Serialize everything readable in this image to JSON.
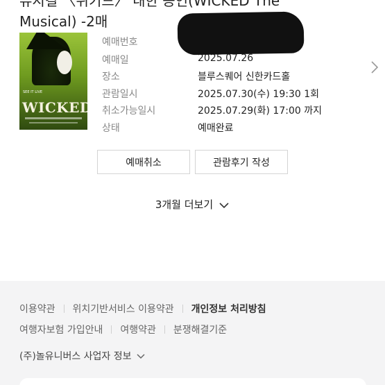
{
  "title": {
    "line1": "뮤지컬 〈위키드〉 내한 공연(WICKED The",
    "line2": "Musical) -2매"
  },
  "poster": {
    "logo": "WICKED",
    "tagline": "SEE IT LIVE"
  },
  "details": [
    {
      "label": "예매번호",
      "value": ""
    },
    {
      "label": "예매일",
      "value": "2025.07.26"
    },
    {
      "label": "장소",
      "value": "블루스퀘어 신한카드홀"
    },
    {
      "label": "관람일시",
      "value": "2025.07.30(수) 19:30 1회"
    },
    {
      "label": "취소가능일시",
      "value": "2025.07.29(화) 17:00 까지"
    },
    {
      "label": "상태",
      "value": "예매완료"
    }
  ],
  "buttons": {
    "cancel": "예매취소",
    "review": "관람후기 작성"
  },
  "more": {
    "label": "3개월 더보기"
  },
  "footer": {
    "links_row1": [
      "이용약관",
      "위치기반서비스 이용약관",
      "개인정보 처리방침"
    ],
    "links_row2": [
      "여행자보험 가입안내",
      "여행약관",
      "분쟁해결기준"
    ],
    "company_info": "(주)놀유니버스 사업자 정보"
  },
  "colors": {
    "label": "#888888",
    "value": "#222222",
    "footer_bg": "#f4f4f5",
    "button_border": "#d4d4d4"
  }
}
